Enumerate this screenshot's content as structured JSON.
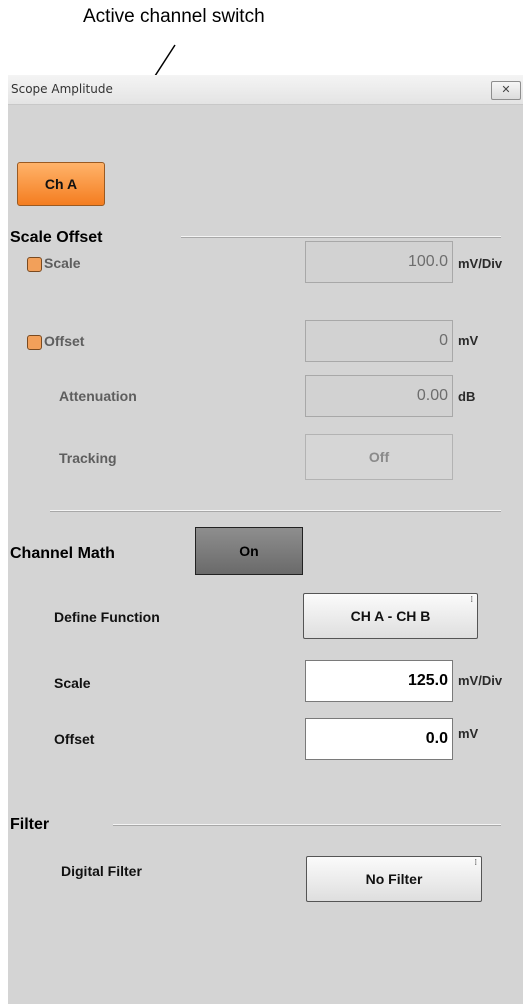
{
  "annotation": {
    "text": "Active channel switch"
  },
  "window": {
    "title": "Scope Amplitude",
    "close_glyph": "✕"
  },
  "channel_button": {
    "label": "Ch A",
    "color": "#f47d20"
  },
  "scale_offset": {
    "heading": "Scale Offset",
    "rows": {
      "scale": {
        "label": "Scale",
        "value": "100.0",
        "unit": "mV/Div",
        "checked": false
      },
      "offset": {
        "label": "Offset",
        "value": "0",
        "unit": "mV",
        "checked": false
      },
      "attenuation": {
        "label": "Attenuation",
        "value": "0.00",
        "unit": "dB"
      },
      "tracking": {
        "label": "Tracking",
        "button_label": "Off"
      }
    }
  },
  "channel_math": {
    "heading": "Channel Math",
    "toggle_label": "On",
    "define_function": {
      "label": "Define Function",
      "value": "CH A - CH B"
    },
    "scale": {
      "label": "Scale",
      "value": "125.0",
      "unit": "mV/Div"
    },
    "offset": {
      "label": "Offset",
      "value": "0.0",
      "unit": "mV"
    }
  },
  "filter": {
    "heading": "Filter",
    "digital_filter": {
      "label": "Digital Filter",
      "value": "No Filter"
    }
  }
}
